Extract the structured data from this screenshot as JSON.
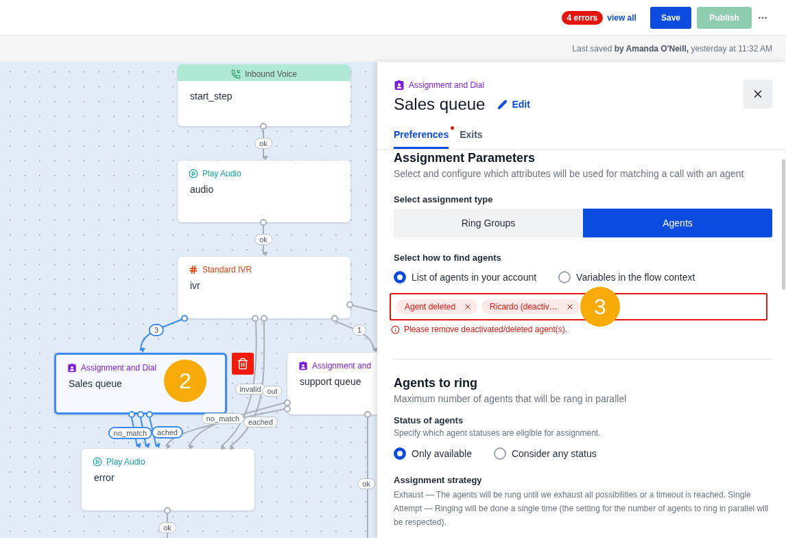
{
  "header": {
    "error_badge": "4 errors",
    "view_all": "view all",
    "buttons": [
      {
        "label": "Save",
        "disabled": false
      },
      {
        "label": "Publish",
        "disabled": true
      }
    ]
  },
  "last_saved": "Last saved **by Amanda O'Neill,** yesterday at 11:32 AM",
  "canvas": {
    "nodes": [
      {
        "kind": "inbound",
        "category": "Inbound Voice",
        "name": "start_step",
        "selected": false
      },
      {
        "kind": "audio",
        "category": "Play Audio",
        "name": "audio",
        "selected": false
      },
      {
        "kind": "ivr",
        "category": "Standard IVR",
        "name": "ivr",
        "selected": false
      },
      {
        "kind": "assign",
        "category": "Assignment and Dial",
        "name": "Sales queue",
        "selected": true
      },
      {
        "kind": "assign",
        "category": "Assignment and",
        "name": "support queue",
        "selected": false
      },
      {
        "kind": "audio",
        "category": "Play Audio",
        "name": "error",
        "selected": false
      }
    ],
    "edge_labels": [
      {
        "text": "ok",
        "active": false
      },
      {
        "text": "ok",
        "active": false
      },
      {
        "text": "3",
        "active": true
      },
      {
        "text": "1",
        "active": false
      },
      {
        "text": "invalid",
        "active": false
      },
      {
        "text": "out",
        "active": false
      },
      {
        "text": "no_match",
        "active": false
      },
      {
        "text": "eached",
        "active": false
      },
      {
        "text": "no_match",
        "active": true
      },
      {
        "text": "ached",
        "active": true
      },
      {
        "text": "ok",
        "active": false
      },
      {
        "text": "ok",
        "active": false
      }
    ],
    "annotations": [
      "2",
      "3"
    ]
  },
  "panel": {
    "category": "Assignment and Dial",
    "title": "Sales queue",
    "edit": "Edit",
    "tabs": [
      {
        "label": "Preferences",
        "selected": true,
        "error": true
      },
      {
        "label": "Exits",
        "selected": false,
        "error": false
      }
    ],
    "assignment": {
      "heading": "Assignment Parameters",
      "description": "Select and configure which attributes will be used for matching a call with an agent",
      "type_label": "Select assignment type",
      "type_options": [
        {
          "label": "Ring Groups",
          "selected": false
        },
        {
          "label": "Agents",
          "selected": true
        }
      ],
      "find_label": "Select how to find agents",
      "find_options": [
        {
          "label": "List of agents in your account",
          "selected": true
        },
        {
          "label": "Variables in the flow context",
          "selected": false
        }
      ],
      "agents": [
        {
          "label": "Agent deleted"
        },
        {
          "label": "Ricardo (deactiv…"
        }
      ],
      "error": "Please remove deactivated/deleted agent(s)."
    },
    "agents_to_ring": {
      "heading": "Agents to ring",
      "description": "Maximum number of agents that will be rang in parallel",
      "status_label": "Status of agents",
      "status_description": "Specify which agent statuses are eligible for assignment.",
      "status_options": [
        {
          "label": "Only available",
          "selected": true
        },
        {
          "label": "Consider any status",
          "selected": false
        }
      ],
      "strategy_label": "Assignment strategy",
      "strategy_text": "Exhaust — The agents will be rung until we exhaust all possibilities or a timeout is reached. Single Attempt — Ringing will be done a single time (the setting for the number of agents to ring in parallel will be respected)."
    }
  }
}
